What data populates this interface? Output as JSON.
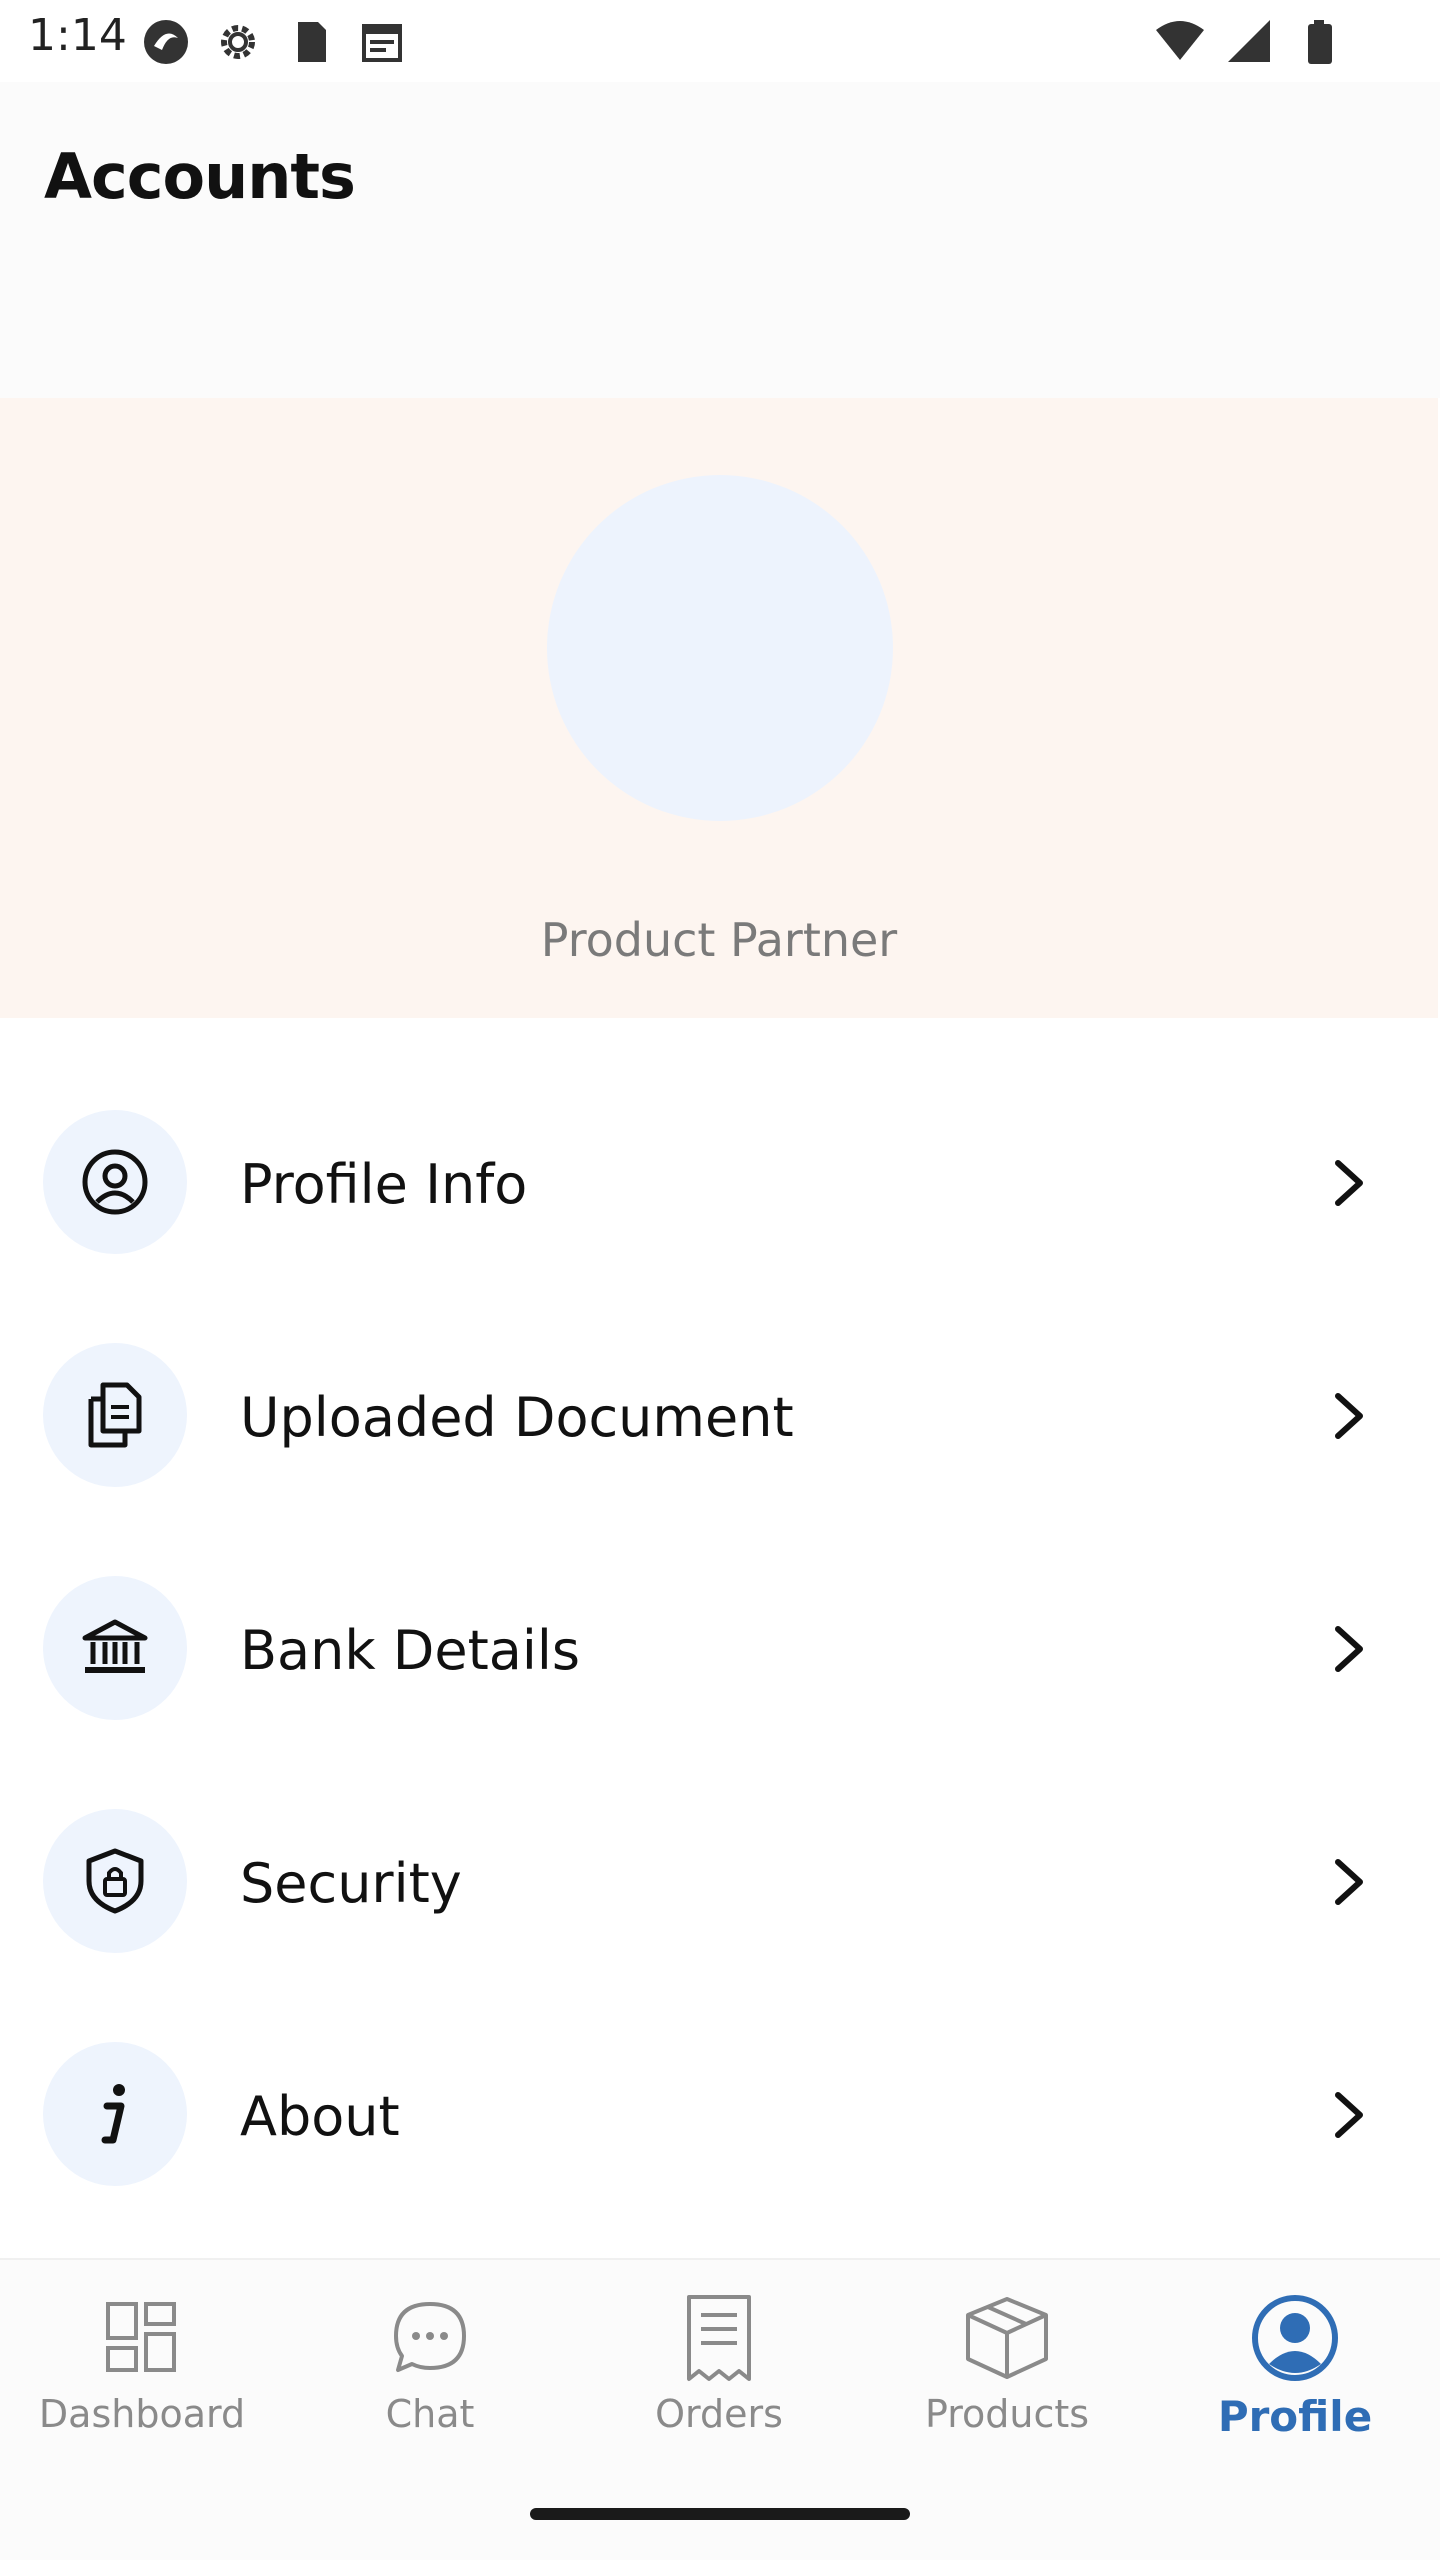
{
  "status_bar": {
    "time": "1:14",
    "left_icons": [
      "app-icon",
      "settings-icon",
      "sd-card-icon",
      "calendar-icon"
    ],
    "right_icons": [
      "wifi-icon",
      "signal-icon",
      "battery-icon"
    ]
  },
  "header": {
    "title": "Accounts"
  },
  "profile": {
    "role": "Product Partner",
    "avatar_color": "#edf3fd",
    "banner_color": "#fdf5f0"
  },
  "menu": {
    "items": [
      {
        "label": "Profile Info",
        "icon": "profile-icon"
      },
      {
        "label": "Uploaded Document",
        "icon": "documents-icon"
      },
      {
        "label": "Bank Details",
        "icon": "bank-icon"
      },
      {
        "label": "Security",
        "icon": "shield-lock-icon"
      },
      {
        "label": "About",
        "icon": "info-icon"
      }
    ]
  },
  "bottom_nav": {
    "items": [
      {
        "label": "Dashboard",
        "icon": "dashboard-icon",
        "active": false
      },
      {
        "label": "Chat",
        "icon": "chat-icon",
        "active": false
      },
      {
        "label": "Orders",
        "icon": "receipt-icon",
        "active": false
      },
      {
        "label": "Products",
        "icon": "box-icon",
        "active": false
      },
      {
        "label": "Profile",
        "icon": "profile-icon",
        "active": true
      }
    ],
    "active_color": "#2f6db5",
    "inactive_color": "#8a8a8a"
  }
}
